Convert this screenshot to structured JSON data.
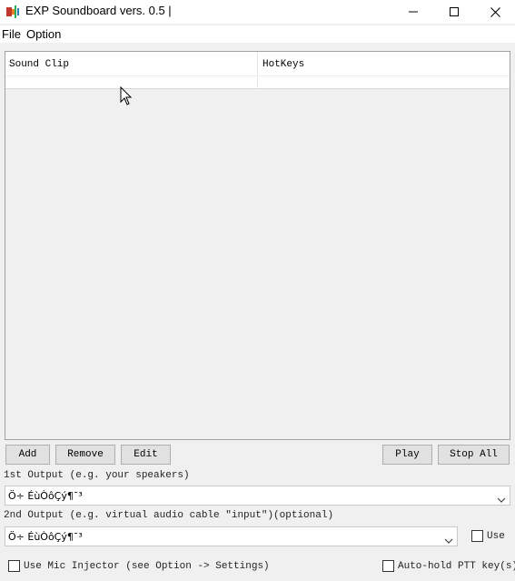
{
  "window": {
    "title": "EXP Soundboard vers. 0.5 |"
  },
  "menu": {
    "file": "File",
    "option": "Option"
  },
  "list": {
    "columns": [
      "Sound Clip",
      "HotKeys"
    ]
  },
  "buttons": {
    "add": "Add",
    "remove": "Remove",
    "edit": "Edit",
    "play": "Play",
    "stop_all": "Stop All"
  },
  "output1": {
    "label": "1st Output (e.g. your speakers)",
    "value": "Ö÷ ÉùÒôÇý¶¯³"
  },
  "output2": {
    "label": "2nd Output (e.g. virtual audio cable \"input\")(optional)",
    "value": "Ö÷ ÉùÒôÇý¶¯³",
    "use_label": "Use"
  },
  "bottom": {
    "mic_injector_label": "Use Mic Injector (see Option -> Settings)",
    "auto_hold_label": "Auto-hold PTT key(s)"
  },
  "icons": {
    "app": "soundboard-app-icon",
    "minimize": "minimize-icon",
    "maximize": "maximize-icon",
    "close": "close-icon",
    "dropdown": "chevron-down-icon"
  }
}
